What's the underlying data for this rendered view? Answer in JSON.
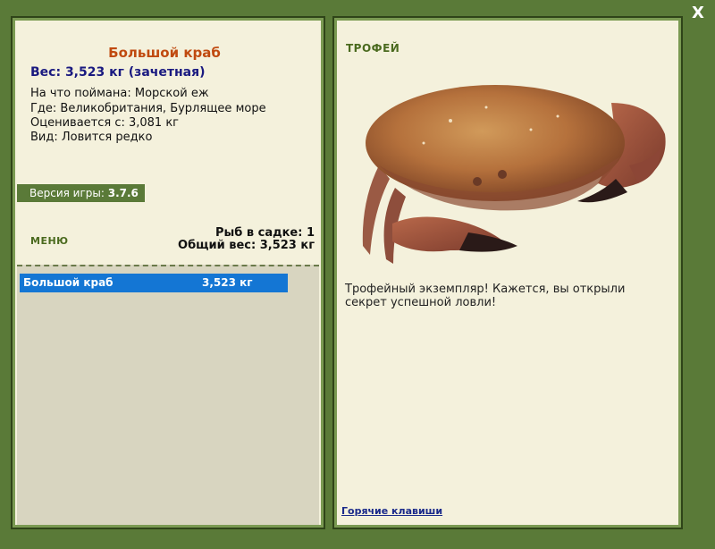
{
  "close_label": "X",
  "fish": {
    "title": "Большой краб",
    "weight_line": "Вес: 3,523 кг (зачетная)",
    "caught_on": "На что поймана: Морской еж",
    "where": "Где: Великобритания, Бурлящее море",
    "valued_from": "Оценивается с: 3,081 кг",
    "kind": "Вид: Ловится редко"
  },
  "version": {
    "label": "Версия игры:",
    "value": "3.7.6"
  },
  "menu_label": "МЕНЮ",
  "stats": {
    "fish_in_cage": "Рыб в садке: 1",
    "total_weight": "Общий вес: 3,523 кг"
  },
  "cage": {
    "items": [
      {
        "name": "Большой краб",
        "weight": "3,523 кг"
      }
    ]
  },
  "trophy": {
    "label": "ТРОФЕЙ",
    "text": "Трофейный экземпляр! Кажется, вы открыли секрет успешной ловли!"
  },
  "hotkeys_label": "Горячие клавиши",
  "colors": {
    "background": "#5a7a38",
    "panel": "#f4f1dc",
    "title": "#c04a10",
    "weight": "#1a1a80",
    "selection": "#1476d4"
  },
  "icons": {
    "close": "close-icon",
    "crab": "crab-image"
  }
}
